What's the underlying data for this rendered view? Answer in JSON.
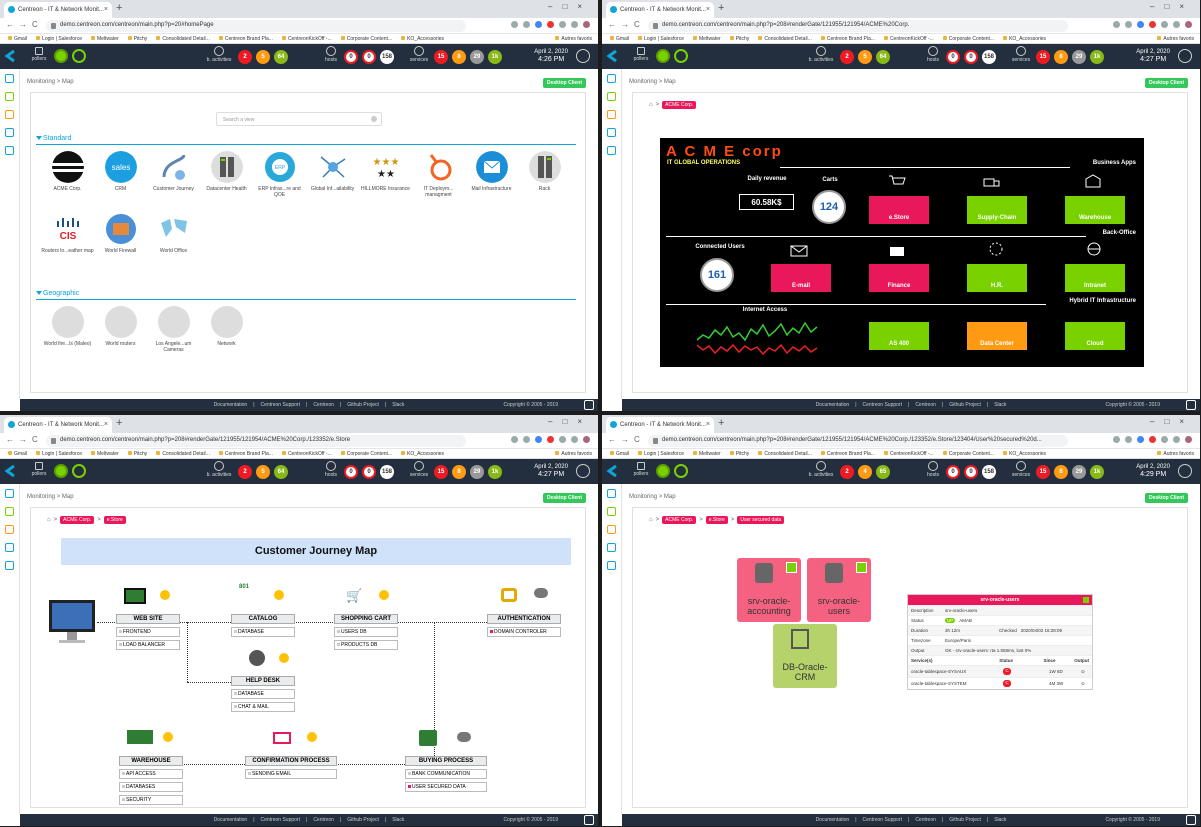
{
  "browser": {
    "tab_title": "Centreon - IT & Network Monit...",
    "bookmarks": [
      "Gmail",
      "Login | Salesforce",
      "Meltwater",
      "Pitchy",
      "Consolidated Detail...",
      "Centreon Brand Pla...",
      "CentreonKickOff -...",
      "Corporate Content...",
      "KO_Accessories"
    ],
    "bookmarks_right": "Autres favoris",
    "urls": [
      "demo.centreon.com/centreon/main.php?p=20#homePage",
      "demo.centreon.com/centreon/main.php?p=208#renderGate/121955/121954/ACME%20Corp.",
      "demo.centreon.com/centreon/main.php?p=208#renderGate/121955/121954/ACME%20Corp./123352/e.Store",
      "demo.centreon.com/centreon/main.php?p=208#renderGate/121955/121954/ACME%20Corp./123352/e.Store/123404/User%20secured%20d..."
    ]
  },
  "header": {
    "pollers": "pollers",
    "b_activities": "b. activities",
    "hosts": "hosts",
    "services": "services",
    "date": "April 2, 2020",
    "times": [
      "4:26 PM",
      "4:27 PM",
      "4:27 PM",
      "4:29 PM"
    ],
    "ba_counts": [
      [
        "2",
        "5",
        "64"
      ],
      [
        "2",
        "5",
        "64"
      ],
      [
        "2",
        "5",
        "64"
      ],
      [
        "2",
        "4",
        "65"
      ]
    ],
    "host_counts": [
      "0",
      "0",
      "158"
    ],
    "svc_counts": [
      "15",
      "8",
      "29",
      "1k"
    ]
  },
  "crumb": {
    "monitoring": "Monitoring",
    "sep": ">",
    "map": "Map"
  },
  "desktop_client": "Desktop Client",
  "footer": {
    "links": [
      "Documentation",
      "|",
      "Centreon Support",
      "|",
      "Centreon",
      "|",
      "Github Project",
      "|",
      "Slack"
    ],
    "copyright": "Copyright © 2005 - 2019"
  },
  "home": {
    "search_placeholder": "Search a view",
    "standard": "Standard",
    "standard_tiles": [
      "ACME Corp.",
      "CRM",
      "Customer Journey",
      "Datacenter Health",
      "ERP Infras...re and QOE",
      "Global Inf...ailability",
      "HILLMORE Insurance",
      "IT Deploym... managment",
      "Mail Infrastructure",
      "Rack",
      "Routers lo...eather map",
      "World Firewall",
      "World Office"
    ],
    "geographic": "Geographic",
    "geo_tiles": [
      "World fire...ls (Maleo)",
      "World routers",
      "Los Angele...um Cameras",
      "Network"
    ],
    "crm_text": "sales",
    "cis_text": "CIS",
    "erp_text": "ERP"
  },
  "acme": {
    "crumb": "ACME Corp.",
    "title": "A C M E corp",
    "subtitle": "IT GLOBAL OPERATIONS",
    "business_apps": "Business Apps",
    "back_office": "Back-Office",
    "hybrid": "Hybrid IT Infrastructure",
    "daily_revenue": "Daily revenue",
    "revenue_value": "60.58K$",
    "carts": "Carts",
    "carts_value": "124",
    "connected_users": "Connected Users",
    "users_value": "161",
    "internet_access": "Internet Access",
    "boxes": [
      "e.Store",
      "Supply-Chain",
      "Warehouse",
      "E-mail",
      "Finance",
      "H.R.",
      "Intranet",
      "AS 400",
      "Data Center",
      "Cloud"
    ]
  },
  "estore": {
    "crumb": "e.Store",
    "title": "Customer Journey Map",
    "nodes": {
      "website": {
        "title": "WEB SITE",
        "items": [
          "FRONTEND",
          "LOAD BALANCER"
        ]
      },
      "catalog": {
        "title": "CATALOG",
        "items": [
          "DATABASE"
        ]
      },
      "cart": {
        "title": "SHOPPING CART",
        "items": [
          "USERS DB",
          "PRODUCTS DB"
        ]
      },
      "auth": {
        "title": "AUTHENTICATION",
        "items": [
          "DOMAIN CONTROLER"
        ]
      },
      "helpdesk": {
        "title": "HELP DESK",
        "items": [
          "DATABASE",
          "CHAT & MAIL"
        ]
      },
      "warehouse": {
        "title": "WAREHOUSE",
        "items": [
          "API ACCESS",
          "DATABASES",
          "SECURITY"
        ]
      },
      "confirm": {
        "title": "CONFIRMATION PROCESS",
        "items": [
          "SENDING EMAIL"
        ]
      },
      "buying": {
        "title": "BUYING PROCESS",
        "items": [
          "BANK COMMUNICATION",
          "USER SECURED DATA"
        ]
      }
    },
    "catalog_icon_text": "801"
  },
  "secured": {
    "crumb": "User secured data",
    "hosts": [
      "srv-oracle-accounting",
      "srv-oracle-users",
      "DB-Oracle-CRM"
    ],
    "tip": {
      "title": "srv-oracle-users",
      "description_k": "Description",
      "description_v": "srv-oracle-users",
      "status_k": "Status",
      "status_v": "UP",
      "status_extra": "AMAB",
      "duration_k": "Duration",
      "duration_v": "3h 12m",
      "checked_k": "Checked",
      "checked_v": "2020/04/02 16:28:09",
      "timezone_k": "Timezone",
      "timezone_v": "Europe/Paris",
      "output_k": "Output",
      "output_v": "OK - srv-oracle-users: rta 1.558ms, lost 0%",
      "col_service": "Service(s)",
      "col_status": "Status",
      "col_since": "Since",
      "col_output": "Output",
      "services": [
        {
          "name": "oracle-tablespace-SYSAUX",
          "status": "C",
          "since": "1W 6D"
        },
        {
          "name": "oracle-tablespace-SYSTEM",
          "status": "C",
          "since": "4M 3W"
        }
      ]
    }
  },
  "colors": {
    "header": "#232f3e",
    "critical": "#ed1c24",
    "warning": "#ff9a13",
    "ok": "#79d100",
    "brand": "#10a4d8",
    "pink": "#e8185a"
  }
}
